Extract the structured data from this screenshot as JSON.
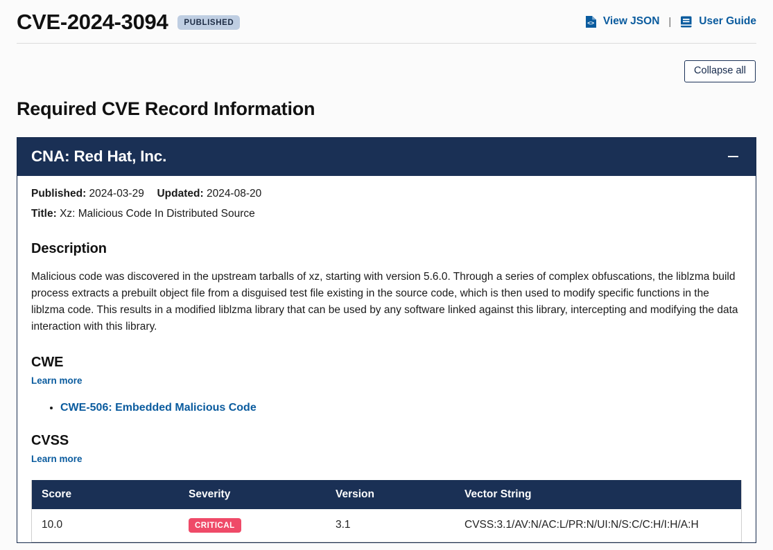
{
  "header": {
    "cve_id": "CVE-2024-3094",
    "state_badge": "PUBLISHED",
    "view_json_label": "View JSON",
    "divider": "|",
    "user_guide_label": "User Guide",
    "view_json_icon": "file-code-icon",
    "user_guide_icon": "book-icon"
  },
  "toolbar": {
    "collapse_all_label": "Collapse all"
  },
  "main": {
    "section_title": "Required CVE Record Information"
  },
  "cna_panel": {
    "title": "CNA: Red Hat, Inc.",
    "toggle_icon": "minus-icon",
    "published_label": "Published:",
    "published_value": "2024-03-29",
    "updated_label": "Updated:",
    "updated_value": "2024-08-20",
    "title_label": "Title:",
    "title_value": "Xz: Malicious Code In Distributed Source",
    "description_heading": "Description",
    "description_text": "Malicious code was discovered in the upstream tarballs of xz, starting with version 5.6.0.  Through a series of complex obfuscations, the liblzma build process extracts a prebuilt object file from a disguised test file existing in the source code, which is then used to modify specific functions in the liblzma code. This results in a modified liblzma library that can be used by any software linked against this library, intercepting and modifying the data interaction with this library.",
    "cwe_heading": "CWE",
    "cwe_learn_more": "Learn more",
    "cwe_items": [
      "CWE-506: Embedded Malicious Code"
    ],
    "cvss_heading": "CVSS",
    "cvss_learn_more": "Learn more",
    "cvss_table": {
      "columns": [
        "Score",
        "Severity",
        "Version",
        "Vector String"
      ],
      "rows": [
        {
          "score": "10.0",
          "severity": "CRITICAL",
          "version": "3.1",
          "vector": "CVSS:3.1/AV:N/AC:L/PR:N/UI:N/S:C/C:H/I:H/A:H"
        }
      ]
    }
  },
  "colors": {
    "panel_navy": "#1a3055",
    "link_blue": "#0a5b9e",
    "critical_red": "#ef4a68",
    "state_badge_bg": "#bfcee2",
    "page_bg": "#fbfbfb"
  }
}
